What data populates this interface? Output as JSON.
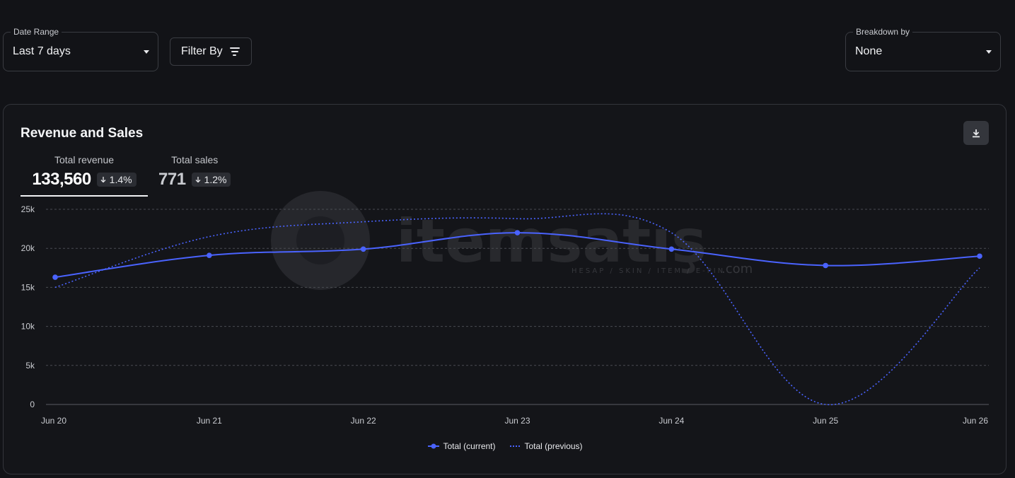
{
  "filters": {
    "date_range": {
      "label": "Date Range",
      "value": "Last 7 days"
    },
    "filter_by": {
      "label": "Filter By"
    },
    "breakdown": {
      "label": "Breakdown by",
      "value": "None"
    }
  },
  "card": {
    "title": "Revenue and Sales",
    "metrics": {
      "revenue": {
        "label": "Total revenue",
        "value": "133,560",
        "change": "1.4%"
      },
      "sales": {
        "label": "Total sales",
        "value": "771",
        "change": "1.2%"
      }
    }
  },
  "watermark": {
    "text": "itemsatış",
    "tagline": "HESAP / SKIN / ITEM / E-PIN",
    "suffix": ".com"
  },
  "chart_data": {
    "type": "line",
    "categories": [
      "Jun 20",
      "Jun 21",
      "Jun 22",
      "Jun 23",
      "Jun 24",
      "Jun 25",
      "Jun 26"
    ],
    "series": [
      {
        "name": "Total (current)",
        "values": [
          16300,
          19100,
          19900,
          22000,
          19900,
          17800,
          19000
        ],
        "color": "#4a63ff",
        "style": "solid",
        "markers": true
      },
      {
        "name": "Total (previous)",
        "values": [
          15000,
          21500,
          23400,
          23800,
          22000,
          0,
          17500
        ],
        "color": "#4a63ff",
        "style": "dotted",
        "markers": false
      }
    ],
    "y_ticks": [
      "0",
      "5k",
      "10k",
      "15k",
      "20k",
      "25k"
    ],
    "ylim": [
      0,
      25000
    ],
    "grid": true,
    "legend": "bottom-center"
  }
}
